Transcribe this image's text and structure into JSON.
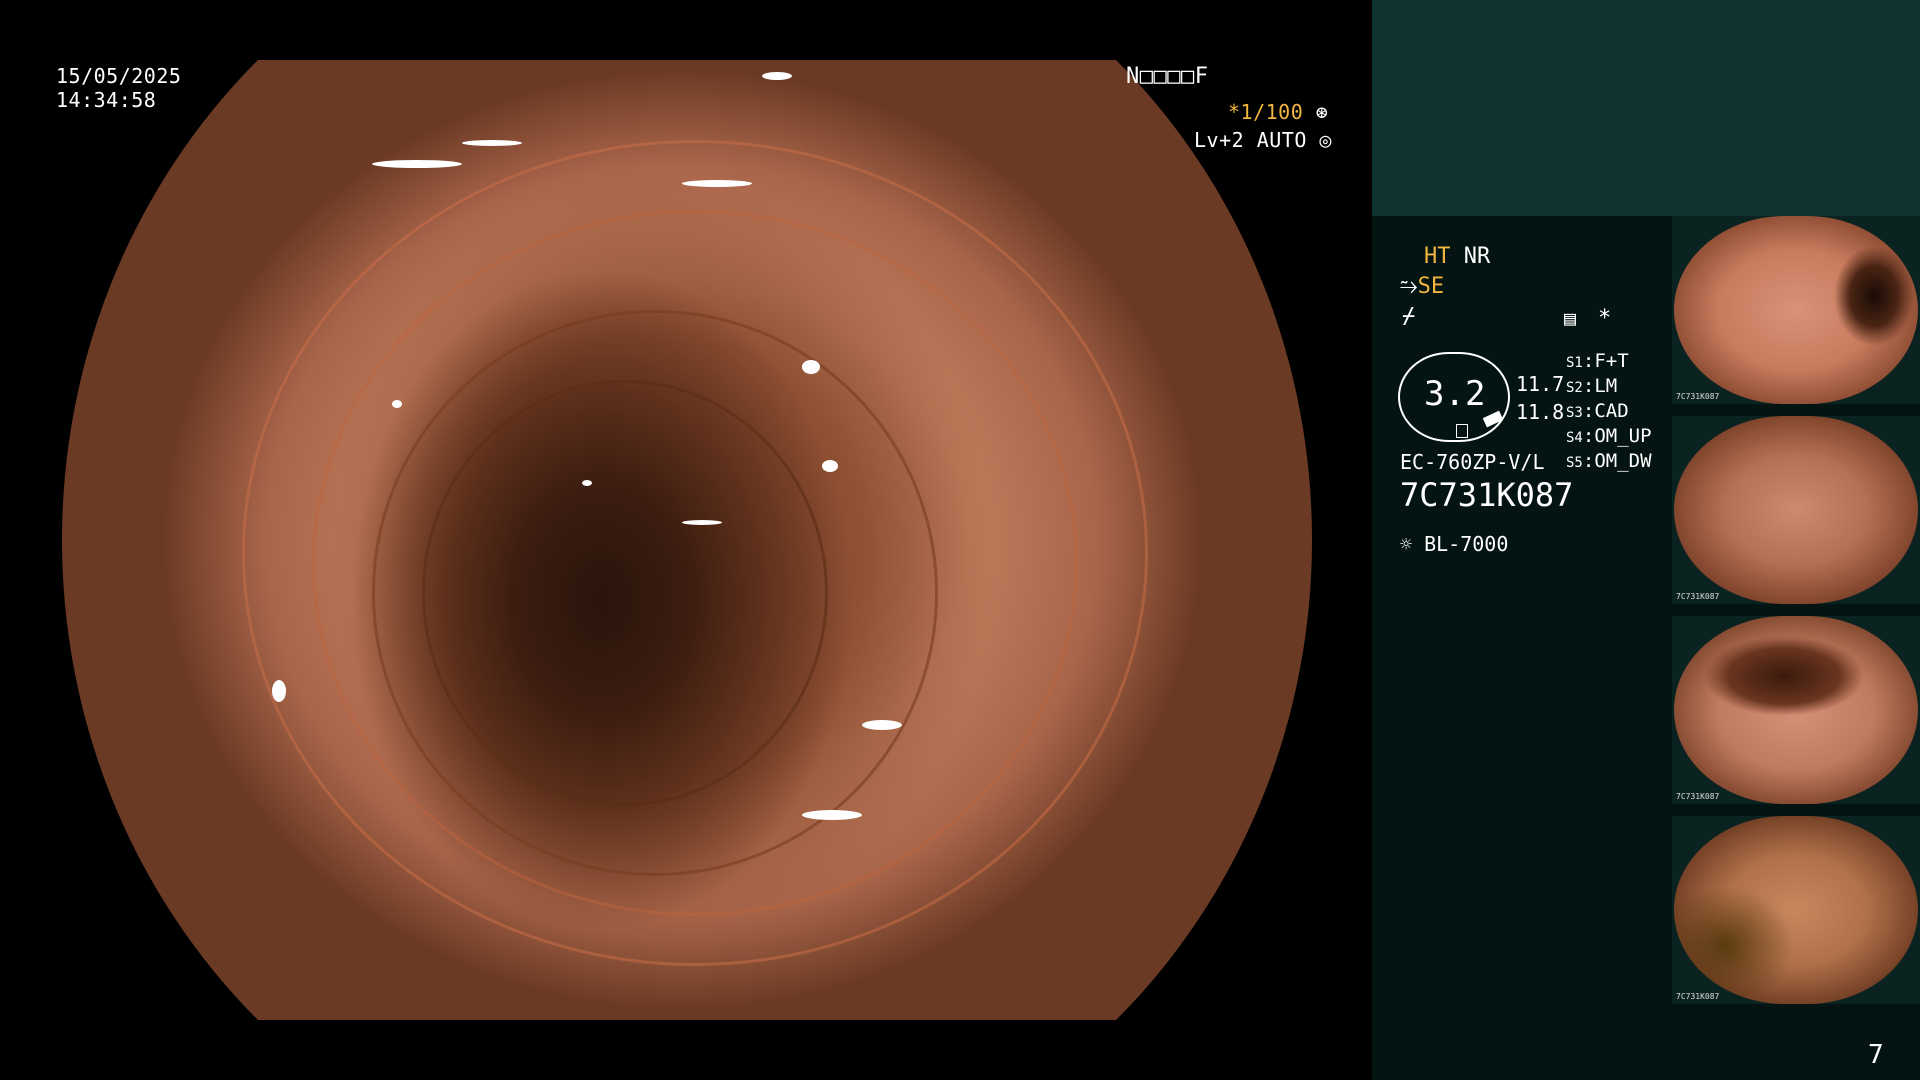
{
  "overlay": {
    "date": "15/05/2025",
    "time": "14:34:58",
    "status_code": "N□□□□F",
    "shutter": "*1/100",
    "level_mode": "Lv+2 AUTO"
  },
  "panel": {
    "ht": "HT",
    "nr": "NR",
    "se": "SE",
    "zoom_value": "3.2",
    "value_1": "11.7",
    "value_2": "11.8",
    "scope_model": "EC-760ZP-V/L",
    "serial": "7C731K087",
    "light_source": "BL-7000",
    "presets": [
      {
        "key": "S1",
        "value": "F+T"
      },
      {
        "key": "S2",
        "value": "LM"
      },
      {
        "key": "S3",
        "value": "CAD"
      },
      {
        "key": "S4",
        "value": "OM_UP"
      },
      {
        "key": "S5",
        "value": "OM_DW"
      }
    ],
    "asterisk": "*",
    "thumb_caption": "7C731K087",
    "page_number": "7"
  },
  "icons": [
    "shutter-icon",
    "auto-iris-icon",
    "structure-icon",
    "color-icon",
    "menu-icon",
    "lamp-icon"
  ],
  "colors": {
    "amber": "#f2b640",
    "panel_dark": "#041412",
    "panel_top": "#0f3330"
  }
}
